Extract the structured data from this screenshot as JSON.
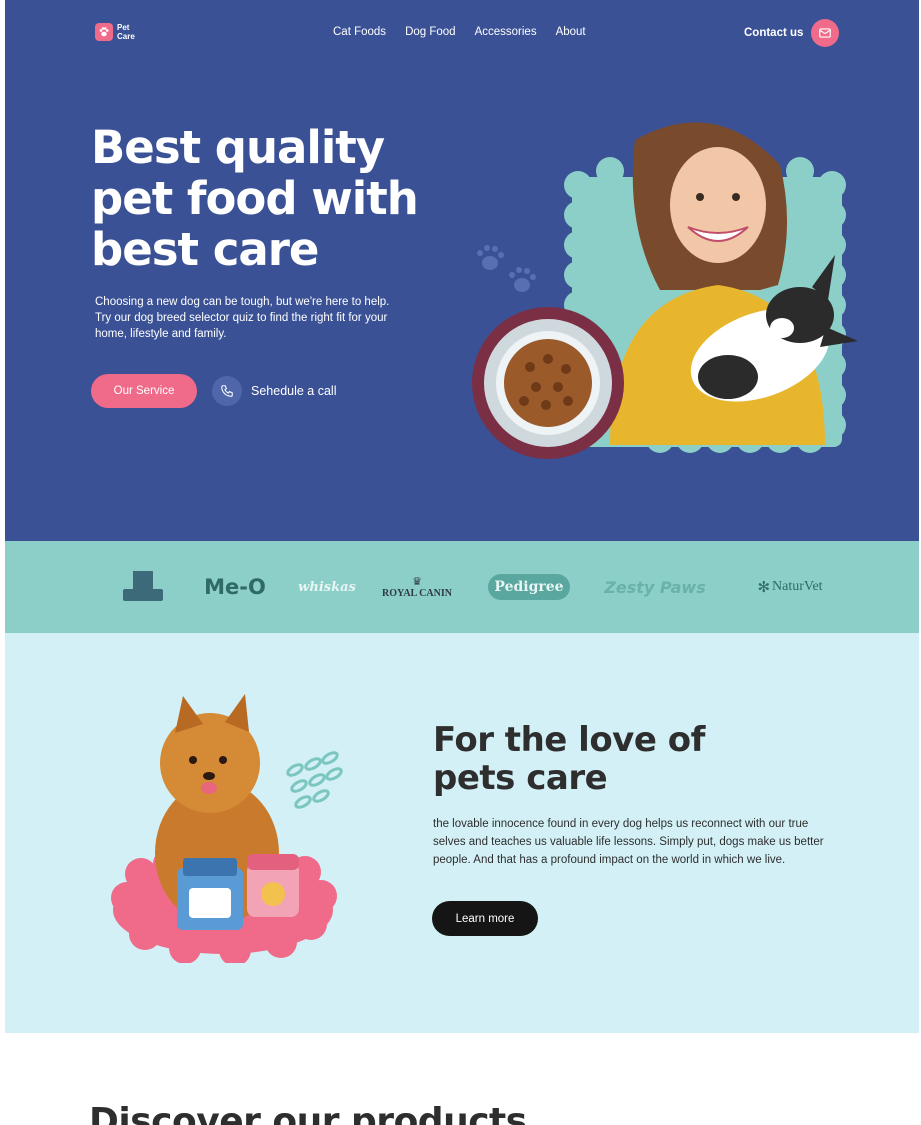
{
  "nav": {
    "logo_line1": "Pet",
    "logo_line2": "Care",
    "links": [
      "Cat Foods",
      "Dog Food",
      "Accessories",
      "About"
    ],
    "contact_label": "Contact us"
  },
  "hero": {
    "title_line1": "Best quality",
    "title_line2": "pet food with",
    "title_line3": "best care",
    "subtitle": "Choosing a new dog can be tough, but we're here to help. Try our dog breed selector quiz to find the right fit for your home, lifestyle and family.",
    "service_button": "Our Service",
    "schedule_label": "Sehedule a call"
  },
  "brands": [
    "Hill's",
    "Me-O",
    "whiskas",
    "ROYAL CANIN",
    "Pedigree",
    "Zesty Paws",
    "NaturVet"
  ],
  "about": {
    "title_line1": "For the love of",
    "title_line2": "pets care",
    "body": "the lovable innocence found in every dog helps us reconnect with our true selves and teaches us valuable life lessons. Simply put, dogs make us better people. And that has a profound impact on the world in which we live.",
    "learn_button": "Learn more"
  },
  "products": {
    "title": "Discover our products"
  },
  "colors": {
    "hero_bg": "#3a5196",
    "accent_pink": "#ef6b89",
    "brands_bg": "#8bcfc8",
    "about_bg": "#d2f0f6",
    "dark": "#151515"
  }
}
